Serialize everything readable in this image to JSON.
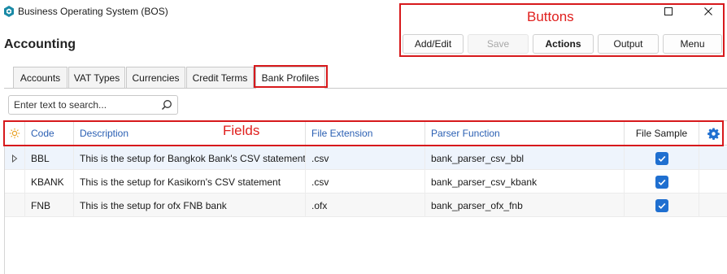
{
  "window": {
    "title": "Business Operating System (BOS)",
    "maximize_icon": "maximize-icon",
    "close_icon": "close-icon"
  },
  "page": {
    "title": "Accounting"
  },
  "annotations": {
    "buttons_label": "Buttons",
    "fields_label": "Fields",
    "color": "#d7191c"
  },
  "toolbar": {
    "add_edit": "Add/Edit",
    "save": "Save",
    "actions": "Actions",
    "output": "Output",
    "menu": "Menu"
  },
  "tabs": [
    {
      "label": "Accounts",
      "active": false
    },
    {
      "label": "VAT Types",
      "active": false
    },
    {
      "label": "Currencies",
      "active": false
    },
    {
      "label": "Credit Terms",
      "active": false
    },
    {
      "label": "Bank Profiles",
      "active": true
    }
  ],
  "search": {
    "placeholder": "Enter text to search...",
    "value": ""
  },
  "grid": {
    "columns": {
      "code": "Code",
      "description": "Description",
      "file_extension": "File Extension",
      "parser_function": "Parser Function",
      "file_sample": "File Sample"
    },
    "header_icons": {
      "left": "sun-icon",
      "right": "gear-icon"
    },
    "rows": [
      {
        "code": "BBL",
        "description": "This is the setup for Bangkok Bank's CSV statement",
        "file_extension": ".csv",
        "parser_function": "bank_parser_csv_bbl",
        "file_sample": true,
        "current": true
      },
      {
        "code": "KBANK",
        "description": "This is the setup for Kasikorn's CSV statement",
        "file_extension": ".csv",
        "parser_function": "bank_parser_csv_kbank",
        "file_sample": true,
        "current": false
      },
      {
        "code": "FNB",
        "description": "This is the setup for ofx FNB bank",
        "file_extension": ".ofx",
        "parser_function": "bank_parser_ofx_fnb",
        "file_sample": true,
        "current": false
      }
    ]
  },
  "colors": {
    "accent": "#1f6fd0",
    "header_text": "#2a5fb3",
    "highlight_icon": "#e8a020"
  }
}
